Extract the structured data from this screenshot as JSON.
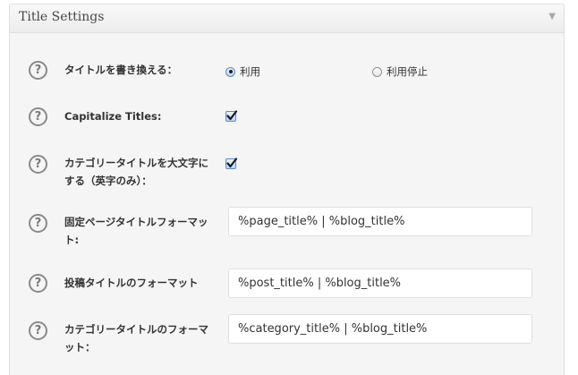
{
  "panel": {
    "title": "Title Settings",
    "toggle_icon": "triangle-down"
  },
  "rows": [
    {
      "help": "?",
      "label": "タイトルを書き換える：",
      "type": "radio",
      "options": [
        {
          "label": "利用",
          "checked": true
        },
        {
          "label": "利用停止",
          "checked": false
        }
      ]
    },
    {
      "help": "?",
      "label": "Capitalize Titles:",
      "type": "checkbox",
      "checked": true
    },
    {
      "help": "?",
      "label": "カテゴリータイトルを大文字にする（英字のみ）：",
      "type": "checkbox",
      "checked": true
    },
    {
      "help": "?",
      "label": "固定ページタイトルフォーマット:",
      "type": "text",
      "value": "%page_title% | %blog_title%"
    },
    {
      "help": "?",
      "label": "投稿タイトルのフォーマット",
      "type": "text",
      "value": "%post_title% | %blog_title%"
    },
    {
      "help": "?",
      "label": "カテゴリータイトルのフォーマット：",
      "type": "text",
      "value": "%category_title% | %blog_title%"
    }
  ],
  "colors": {
    "panel_bg": "#f5f5f5",
    "border": "#dfdfdf",
    "label_text": "#333333",
    "help_icon": "#8a8a8a",
    "check_accent": "#5b8cc8"
  }
}
